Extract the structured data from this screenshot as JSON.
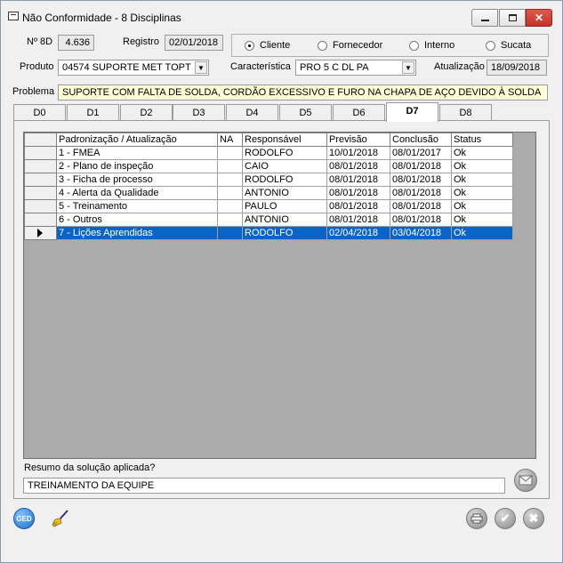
{
  "window": {
    "title": "Não Conformidade - 8 Disciplinas"
  },
  "header": {
    "n8d_label": "Nº 8D",
    "n8d_value": "4.636",
    "registro_label": "Registro",
    "registro_value": "02/01/2018",
    "origin_options": [
      {
        "label": "Cliente",
        "selected": true
      },
      {
        "label": "Fornecedor",
        "selected": false
      },
      {
        "label": "Interno",
        "selected": false
      },
      {
        "label": "Sucata",
        "selected": false
      }
    ],
    "produto_label": "Produto",
    "produto_value": "04574  SUPORTE MET TOPT",
    "caracteristica_label": "Característica",
    "caracteristica_value": "PRO  5  C DL PA",
    "atualizacao_label": "Atualização",
    "atualizacao_value": "18/09/2018",
    "problema_label": "Problema",
    "problema_value": "SUPORTE COM FALTA DE SOLDA, CORDÃO EXCESSIVO E FURO NA CHAPA DE AÇO DEVIDO À SOLDA"
  },
  "tabs": [
    "D0",
    "D1",
    "D2",
    "D3",
    "D4",
    "D5",
    "D6",
    "D7",
    "D8"
  ],
  "active_tab": "D7",
  "grid": {
    "columns": [
      "Padronização / Atualização",
      "NA",
      "Responsável",
      "Previsão",
      "Conclusão",
      "Status"
    ],
    "rows": [
      [
        "1 - FMEA",
        "",
        "RODOLFO",
        "10/01/2018",
        "08/01/2017",
        "Ok"
      ],
      [
        "2 - Plano de inspeção",
        "",
        "CAIO",
        "08/01/2018",
        "08/01/2018",
        "Ok"
      ],
      [
        "3 - Ficha de processo",
        "",
        "RODOLFO",
        "08/01/2018",
        "08/01/2018",
        "Ok"
      ],
      [
        "4 - Alerta da Qualidade",
        "",
        "ANTONIO",
        "08/01/2018",
        "08/01/2018",
        "Ok"
      ],
      [
        "5 - Treinamento",
        "",
        "PAULO",
        "08/01/2018",
        "08/01/2018",
        "Ok"
      ],
      [
        "6 - Outros",
        "",
        "ANTONIO",
        "08/01/2018",
        "08/01/2018",
        "Ok"
      ],
      [
        "7 - Lições Aprendidas",
        "",
        "RODOLFO",
        "02/04/2018",
        "03/04/2018",
        "Ok"
      ]
    ],
    "selected_row": 6
  },
  "resumo": {
    "label": "Resumo da solução aplicada?",
    "value": "TREINAMENTO DA EQUIPE"
  },
  "footer": {
    "ged_label": "GED"
  },
  "colors": {
    "selection": "#0a64c8",
    "problem_bg": "#ffffd8",
    "ged_blue": "#2a7fd4"
  }
}
